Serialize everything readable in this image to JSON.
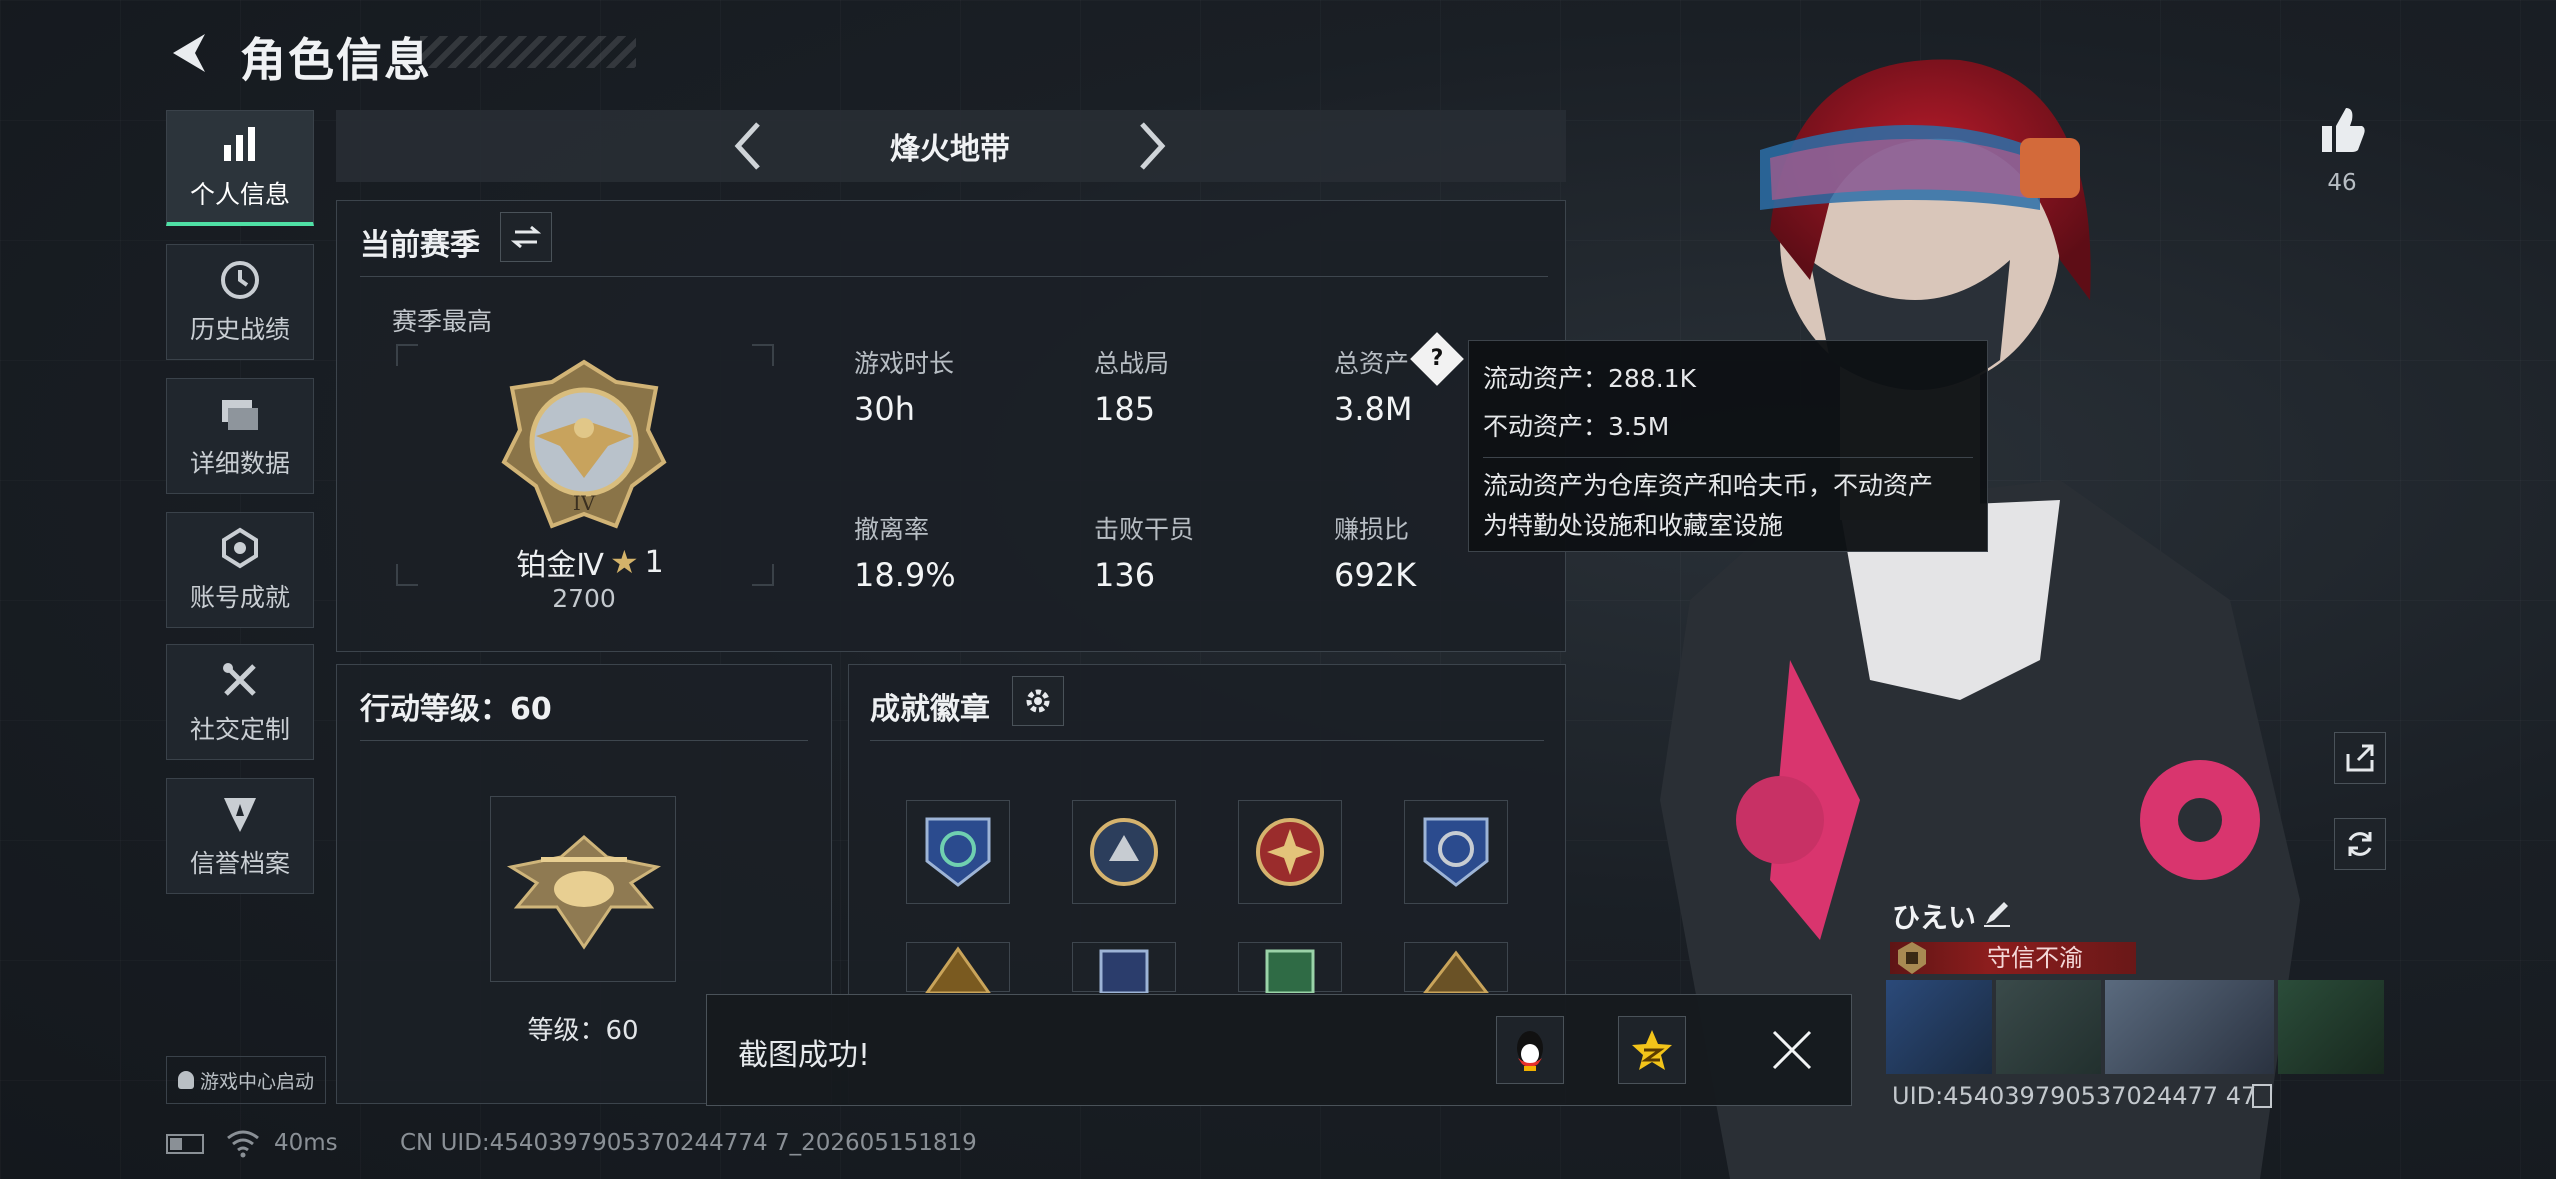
{
  "header": {
    "title": "角色信息"
  },
  "sidebar": {
    "items": [
      {
        "label": "个人信息",
        "icon": "bar-chart-icon"
      },
      {
        "label": "历史战绩",
        "icon": "clock-icon"
      },
      {
        "label": "详细数据",
        "icon": "folder-icon"
      },
      {
        "label": "账号成就",
        "icon": "achievement-icon"
      },
      {
        "label": "社交定制",
        "icon": "tools-icon"
      },
      {
        "label": "信誉档案",
        "icon": "shield-icon"
      }
    ],
    "game_center_label": "游戏中心启动"
  },
  "mode_selector": {
    "label": "烽火地带"
  },
  "season": {
    "title": "当前赛季",
    "best_label": "赛季最高",
    "rank_name": "铂金Ⅳ",
    "rank_stars": "1",
    "rank_points": "2700",
    "stats": [
      {
        "label": "游戏时长",
        "value": "30h"
      },
      {
        "label": "总战局",
        "value": "185"
      },
      {
        "label": "总资产",
        "value": "3.8M"
      },
      {
        "label": "撤离率",
        "value": "18.9%"
      },
      {
        "label": "击败干员",
        "value": "136"
      },
      {
        "label": "赚损比",
        "value": "692K"
      }
    ],
    "help_glyph": "?"
  },
  "tooltip": {
    "liquid": "流动资产：288.1K",
    "fixed": "不动资产：3.5M",
    "desc_line1": "流动资产为仓库资产和哈夫币，不动资产",
    "desc_line2": "为特勤处设施和收藏室设施"
  },
  "action_level": {
    "title": "行动等级：60",
    "level_label": "等级：60"
  },
  "achievements": {
    "title": "成就徽章"
  },
  "likes": {
    "count": "46"
  },
  "player": {
    "name": "ひえい",
    "reputation": "守信不渝",
    "uid_short": "UID:454039790537024477 47"
  },
  "toast": {
    "message": "截图成功!"
  },
  "status_bar": {
    "ping": "40ms",
    "uid_line": "CN UID:4540397905370244774 7_202605151819"
  },
  "colors": {
    "accent": "#4fe0a5",
    "reputation_red": "#8c1d1d",
    "gold": "#c9a45a"
  }
}
